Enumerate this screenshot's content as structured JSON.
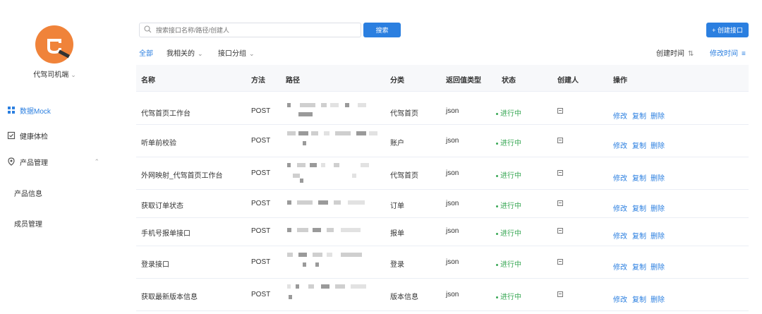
{
  "sidebar": {
    "app_name": "代驾司机端",
    "nav": [
      {
        "label": "数据Mock",
        "icon": "grid-icon",
        "active": true
      },
      {
        "label": "健康体检",
        "icon": "checkbox-icon",
        "active": false
      },
      {
        "label": "产品管理",
        "icon": "location-pin-icon",
        "active": false
      }
    ],
    "sub_items": [
      "产品信息",
      "成员管理"
    ]
  },
  "toolbar": {
    "search_placeholder": "搜索接口名称/路径/创建人",
    "search_label": "搜索",
    "create_label": "+ 创建接口",
    "filters": [
      "全部",
      "我相关的",
      "接口分组"
    ],
    "sort_created": "创建时间",
    "sort_modified": "修改时间"
  },
  "table": {
    "headers": [
      "名称",
      "方法",
      "路径",
      "分类",
      "返回值类型",
      "状态",
      "创建人",
      "操作"
    ],
    "actions": [
      "修改",
      "复制",
      "删除"
    ],
    "rows": [
      {
        "name": "代驾首页工作台",
        "method": "POST",
        "category": "代驾首页",
        "return_type": "json",
        "status": "进行中"
      },
      {
        "name": "听单前校验",
        "method": "POST",
        "category": "账户",
        "return_type": "json",
        "status": "进行中"
      },
      {
        "name": "外网映射_代驾首页工作台",
        "method": "POST",
        "category": "代驾首页",
        "return_type": "json",
        "status": "进行中"
      },
      {
        "name": "获取订单状态",
        "method": "POST",
        "category": "订单",
        "return_type": "json",
        "status": "进行中"
      },
      {
        "name": "手机号报单接口",
        "method": "POST",
        "category": "报单",
        "return_type": "json",
        "status": "进行中"
      },
      {
        "name": "登录接口",
        "method": "POST",
        "category": "登录",
        "return_type": "json",
        "status": "进行中"
      },
      {
        "name": "获取最新版本信息",
        "method": "POST",
        "category": "版本信息",
        "return_type": "json",
        "status": "进行中"
      }
    ]
  },
  "colors": {
    "accent": "#2b7fe0",
    "status_green": "#3aa856",
    "logo_orange": "#f0833a"
  }
}
